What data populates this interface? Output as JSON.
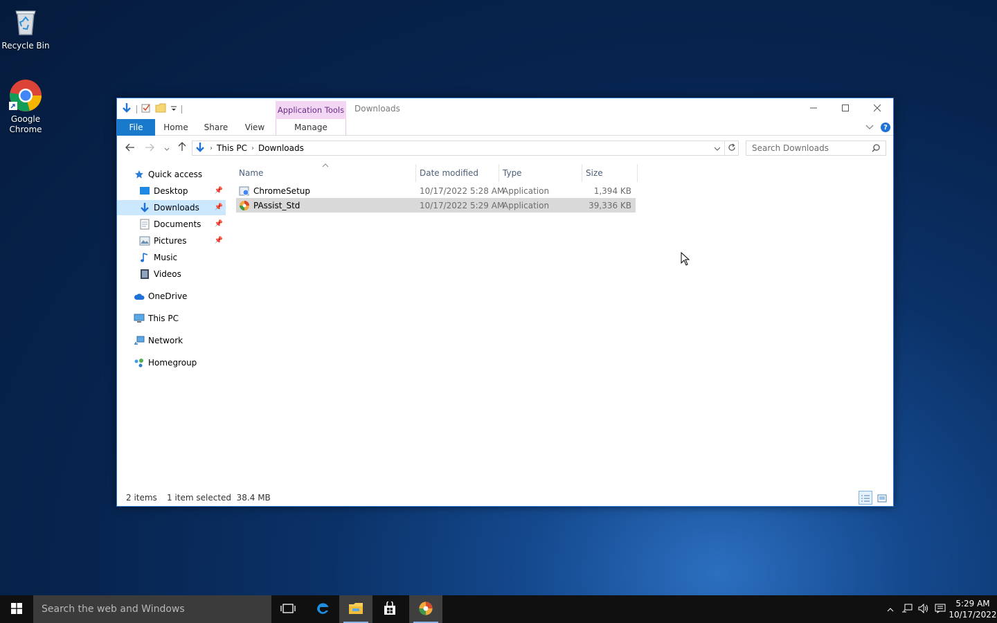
{
  "desktop": {
    "icons": [
      {
        "label": "Recycle Bin",
        "icon": "recycle-bin-icon"
      },
      {
        "label": "Google\nChrome",
        "icon": "chrome-icon"
      }
    ]
  },
  "window": {
    "title": "Downloads",
    "context_tab": "Application Tools",
    "ribbon_tabs": [
      "File",
      "Home",
      "Share",
      "View",
      "Manage"
    ]
  },
  "address": {
    "crumbs": [
      "This PC",
      "Downloads"
    ]
  },
  "search": {
    "placeholder": "Search Downloads"
  },
  "nav": {
    "items": [
      {
        "label": "Quick access",
        "icon": "star-icon"
      },
      {
        "label": "Desktop",
        "icon": "desktop-folder-icon",
        "pinned": true
      },
      {
        "label": "Downloads",
        "icon": "downloads-folder-icon",
        "pinned": true,
        "selected": true
      },
      {
        "label": "Documents",
        "icon": "documents-icon",
        "pinned": true
      },
      {
        "label": "Pictures",
        "icon": "pictures-icon",
        "pinned": true
      },
      {
        "label": "Music",
        "icon": "music-icon"
      },
      {
        "label": "Videos",
        "icon": "videos-icon"
      },
      {
        "label": "OneDrive",
        "icon": "cloud-icon"
      },
      {
        "label": "This PC",
        "icon": "computer-icon"
      },
      {
        "label": "Network",
        "icon": "network-icon"
      },
      {
        "label": "Homegroup",
        "icon": "homegroup-icon"
      }
    ]
  },
  "files": {
    "columns": [
      "Name",
      "Date modified",
      "Type",
      "Size"
    ],
    "rows": [
      {
        "name": "ChromeSetup",
        "date": "10/17/2022 5:28 AM",
        "type": "Application",
        "size": "1,394 KB",
        "selected": false
      },
      {
        "name": "PAssist_Std",
        "date": "10/17/2022 5:29 AM",
        "type": "Application",
        "size": "39,336 KB",
        "selected": true
      }
    ]
  },
  "status": {
    "count": "2 items",
    "selection": "1 item selected  38.4 MB"
  },
  "taskbar": {
    "search_placeholder": "Search the web and Windows",
    "time": "5:29 AM",
    "date": "10/17/2022"
  }
}
